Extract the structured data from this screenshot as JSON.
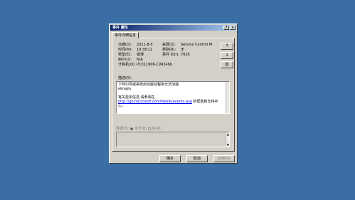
{
  "window": {
    "title": "事件 属性",
    "help_btn": "?",
    "close_btn": "×"
  },
  "tab_label": "事件详细信息",
  "fields": [
    {
      "label": "日期(D):",
      "value": "2011-8-5"
    },
    {
      "label": "时间(M):",
      "value": "19:38:12"
    },
    {
      "label": "类型(E):",
      "value": "错误"
    },
    {
      "label": "用户(U):",
      "value": "N/A"
    },
    {
      "label": "计算机(O):",
      "value": "PC011906-C992466"
    }
  ],
  "fields_right": [
    {
      "label": "来源(S):",
      "value": "Service Control M"
    },
    {
      "label": "类别(R):",
      "value": "无"
    },
    {
      "label": "事件 ID(I):",
      "value": "7026"
    }
  ],
  "nav": {
    "up": "↑",
    "down": "↓",
    "copy": "⧉"
  },
  "description": {
    "label": "描述(D):",
    "line1": "下列引导或系统启动驱动程序无法加载:",
    "line2": "ekrapis",
    "line3": "有关更多信息,请参阅在",
    "link": "http://go.microsoft.com/fwlink/events.asp",
    "line4_suffix": " 的帮助和支持中",
    "line5": "心。"
  },
  "data_section": {
    "label": "数据(T):",
    "opt_bytes": "字节(B)",
    "opt_words": "字(W)"
  },
  "buttons": {
    "ok": "确定",
    "cancel": "取消",
    "apply": "应用(A)"
  }
}
